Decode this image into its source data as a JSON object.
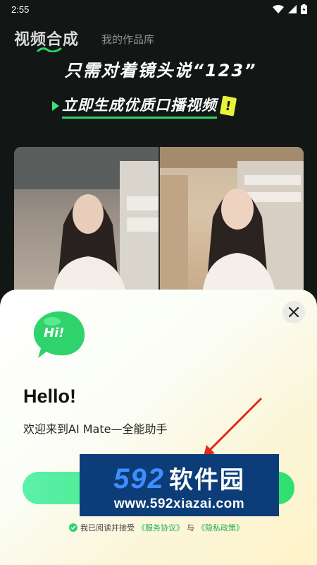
{
  "status_bar": {
    "time": "2:55",
    "icons": [
      "wifi-icon",
      "signal-icon",
      "battery-icon"
    ]
  },
  "header": {
    "tab_active": "视频合成",
    "tab_inactive": "我的作品库"
  },
  "banner": {
    "line1": "只需对着镜头说“123”",
    "line2": "立即生成优质口播视频",
    "badge": "!"
  },
  "sheet": {
    "hi_label": "Hi!",
    "title": "Hello!",
    "subtitle": "欢迎来到AI Mate—全能助手",
    "agreement_prefix": "我已阅读并接受",
    "terms_link": "《服务协议》",
    "conjunction": "与",
    "privacy_link": "《隐私政策》"
  },
  "watermark": {
    "number": "592",
    "brand": "软件园",
    "url": "www.592xiazai.com"
  },
  "colors": {
    "background": "#121615",
    "accent_green": "#2fd36b",
    "watermark_blue": "#0c3d78"
  }
}
